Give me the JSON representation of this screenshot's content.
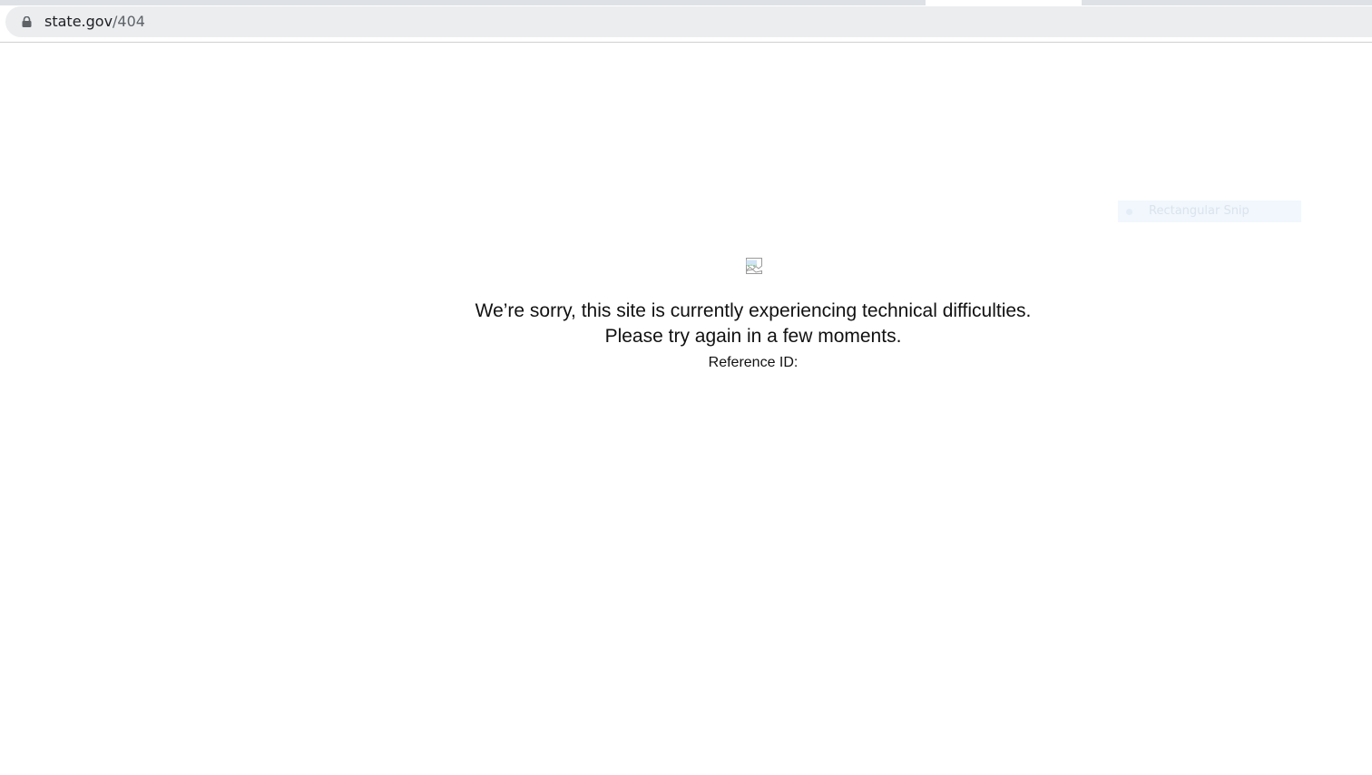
{
  "browser": {
    "url_host": "state.gov",
    "url_path": "/404",
    "lock_icon": "lock-icon"
  },
  "overlay": {
    "snip_label": "Rectangular Snip"
  },
  "page": {
    "image_icon": "broken-image-icon",
    "message_line_1": "We’re sorry, this site is currently experiencing technical difficulties.",
    "message_line_2": "Please try again in a few moments.",
    "reference_label": "Reference ID:"
  },
  "colors": {
    "omnibox_bg": "#ebedef",
    "page_bg": "#ffffff",
    "text": "#111111"
  }
}
